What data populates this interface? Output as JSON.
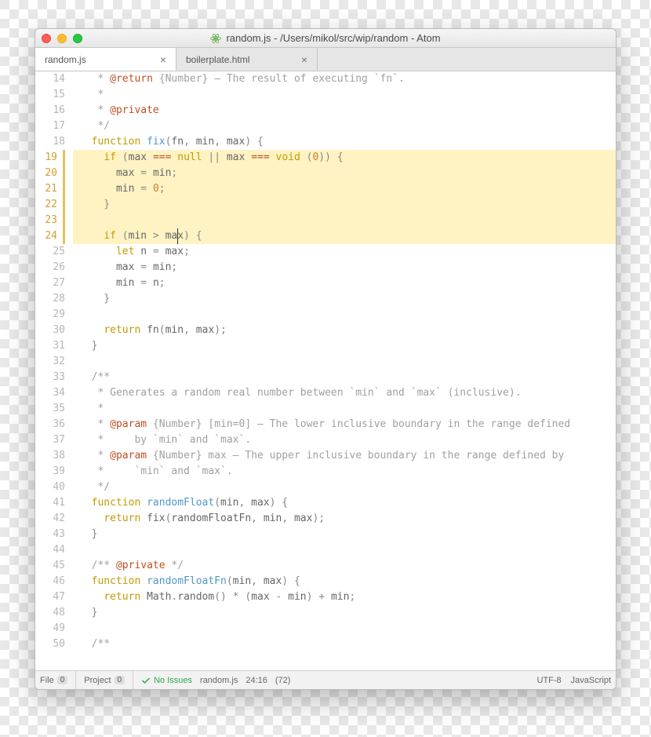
{
  "window": {
    "title": "random.js - /Users/mikol/src/wip/random - Atom"
  },
  "tabs": [
    {
      "label": "random.js",
      "active": true
    },
    {
      "label": "boilerplate.html",
      "active": false
    }
  ],
  "gutter": {
    "start": 14,
    "end": 50,
    "modified": [
      19,
      20,
      21,
      22,
      23,
      24
    ]
  },
  "highlighted_lines": [
    19,
    20,
    21,
    22,
    23,
    24
  ],
  "code": {
    "14": [
      [
        "c",
        "   * "
      ],
      [
        "tag",
        "@return"
      ],
      [
        "c",
        " {Number} – The result of executing `fn`."
      ]
    ],
    "15": [
      [
        "c",
        "   *"
      ]
    ],
    "16": [
      [
        "c",
        "   * "
      ],
      [
        "tag",
        "@private"
      ]
    ],
    "17": [
      [
        "c",
        "   */"
      ]
    ],
    "18": [
      [
        "k",
        "  function "
      ],
      [
        "fn",
        "fix"
      ],
      [
        "p",
        "("
      ],
      [
        "id",
        "fn"
      ],
      [
        "p",
        ", "
      ],
      [
        "id",
        "min"
      ],
      [
        "p",
        ", "
      ],
      [
        "id",
        "max"
      ],
      [
        "p",
        ") {"
      ]
    ],
    "19": [
      [
        "p",
        "    "
      ],
      [
        "k",
        "if"
      ],
      [
        "p",
        " ("
      ],
      [
        "id",
        "max"
      ],
      [
        "p",
        " "
      ],
      [
        "eq",
        "==="
      ],
      [
        "p",
        " "
      ],
      [
        "kw2",
        "null"
      ],
      [
        "p",
        " || "
      ],
      [
        "id",
        "max"
      ],
      [
        "p",
        " "
      ],
      [
        "eq",
        "==="
      ],
      [
        "p",
        " "
      ],
      [
        "kw2",
        "void"
      ],
      [
        "p",
        " ("
      ],
      [
        "num",
        "0"
      ],
      [
        "p",
        ")) {"
      ]
    ],
    "20": [
      [
        "p",
        "      "
      ],
      [
        "id",
        "max"
      ],
      [
        "p",
        " = "
      ],
      [
        "id",
        "min"
      ],
      [
        "p",
        ";"
      ]
    ],
    "21": [
      [
        "p",
        "      "
      ],
      [
        "id",
        "min"
      ],
      [
        "p",
        " = "
      ],
      [
        "num",
        "0"
      ],
      [
        "p",
        ";"
      ]
    ],
    "22": [
      [
        "p",
        "    }"
      ]
    ],
    "23": [
      [
        "p",
        ""
      ]
    ],
    "24": [
      [
        "p",
        "    "
      ],
      [
        "k",
        "if"
      ],
      [
        "p",
        " ("
      ],
      [
        "id",
        "min"
      ],
      [
        "p",
        " > "
      ],
      [
        "id",
        "max"
      ],
      [
        "p",
        ") {"
      ]
    ],
    "25": [
      [
        "p",
        "      "
      ],
      [
        "k",
        "let"
      ],
      [
        "p",
        " "
      ],
      [
        "id",
        "n"
      ],
      [
        "p",
        " = "
      ],
      [
        "id",
        "max"
      ],
      [
        "p",
        ";"
      ]
    ],
    "26": [
      [
        "p",
        "      "
      ],
      [
        "id",
        "max"
      ],
      [
        "p",
        " = "
      ],
      [
        "id",
        "min"
      ],
      [
        "p",
        ";"
      ]
    ],
    "27": [
      [
        "p",
        "      "
      ],
      [
        "id",
        "min"
      ],
      [
        "p",
        " = "
      ],
      [
        "id",
        "n"
      ],
      [
        "p",
        ";"
      ]
    ],
    "28": [
      [
        "p",
        "    }"
      ]
    ],
    "29": [
      [
        "p",
        ""
      ]
    ],
    "30": [
      [
        "p",
        "    "
      ],
      [
        "k",
        "return"
      ],
      [
        "p",
        " "
      ],
      [
        "id",
        "fn"
      ],
      [
        "p",
        "("
      ],
      [
        "id",
        "min"
      ],
      [
        "p",
        ", "
      ],
      [
        "id",
        "max"
      ],
      [
        "p",
        ");"
      ]
    ],
    "31": [
      [
        "p",
        "  }"
      ]
    ],
    "32": [
      [
        "p",
        ""
      ]
    ],
    "33": [
      [
        "c",
        "  /**"
      ]
    ],
    "34": [
      [
        "c",
        "   * Generates a random real number between `min` and `max` (inclusive)."
      ]
    ],
    "35": [
      [
        "c",
        "   *"
      ]
    ],
    "36": [
      [
        "c",
        "   * "
      ],
      [
        "tag",
        "@param"
      ],
      [
        "c",
        " {Number} [min=0] – The lower inclusive boundary in the range defined"
      ]
    ],
    "37": [
      [
        "c",
        "   *     by `min` and `max`."
      ]
    ],
    "38": [
      [
        "c",
        "   * "
      ],
      [
        "tag",
        "@param"
      ],
      [
        "c",
        " {Number} max – The upper inclusive boundary in the range defined by"
      ]
    ],
    "39": [
      [
        "c",
        "   *     `min` and `max`."
      ]
    ],
    "40": [
      [
        "c",
        "   */"
      ]
    ],
    "41": [
      [
        "k",
        "  function "
      ],
      [
        "fn",
        "randomFloat"
      ],
      [
        "p",
        "("
      ],
      [
        "id",
        "min"
      ],
      [
        "p",
        ", "
      ],
      [
        "id",
        "max"
      ],
      [
        "p",
        ") {"
      ]
    ],
    "42": [
      [
        "p",
        "    "
      ],
      [
        "k",
        "return"
      ],
      [
        "p",
        " "
      ],
      [
        "id",
        "fix"
      ],
      [
        "p",
        "("
      ],
      [
        "id",
        "randomFloatFn"
      ],
      [
        "p",
        ", "
      ],
      [
        "id",
        "min"
      ],
      [
        "p",
        ", "
      ],
      [
        "id",
        "max"
      ],
      [
        "p",
        ");"
      ]
    ],
    "43": [
      [
        "p",
        "  }"
      ]
    ],
    "44": [
      [
        "p",
        ""
      ]
    ],
    "45": [
      [
        "c",
        "  /** "
      ],
      [
        "tag",
        "@private"
      ],
      [
        "c",
        " */"
      ]
    ],
    "46": [
      [
        "k",
        "  function "
      ],
      [
        "fn",
        "randomFloatFn"
      ],
      [
        "p",
        "("
      ],
      [
        "id",
        "min"
      ],
      [
        "p",
        ", "
      ],
      [
        "id",
        "max"
      ],
      [
        "p",
        ") {"
      ]
    ],
    "47": [
      [
        "p",
        "    "
      ],
      [
        "k",
        "return"
      ],
      [
        "p",
        " "
      ],
      [
        "id",
        "Math"
      ],
      [
        "p",
        "."
      ],
      [
        "id",
        "random"
      ],
      [
        "p",
        "() * ("
      ],
      [
        "id",
        "max"
      ],
      [
        "p",
        " - "
      ],
      [
        "id",
        "min"
      ],
      [
        "p",
        ") + "
      ],
      [
        "id",
        "min"
      ],
      [
        "p",
        ";"
      ]
    ],
    "48": [
      [
        "p",
        "  }"
      ]
    ],
    "49": [
      [
        "p",
        ""
      ]
    ],
    "50": [
      [
        "c",
        "  /**"
      ]
    ]
  },
  "cursor": {
    "line": 24,
    "col": 16
  },
  "status": {
    "file_label": "File",
    "file_count": "0",
    "project_label": "Project",
    "project_count": "0",
    "issues": "No Issues",
    "filename": "random.js",
    "position": "24:16",
    "selection": "(72)",
    "encoding": "UTF-8",
    "language": "JavaScript"
  }
}
